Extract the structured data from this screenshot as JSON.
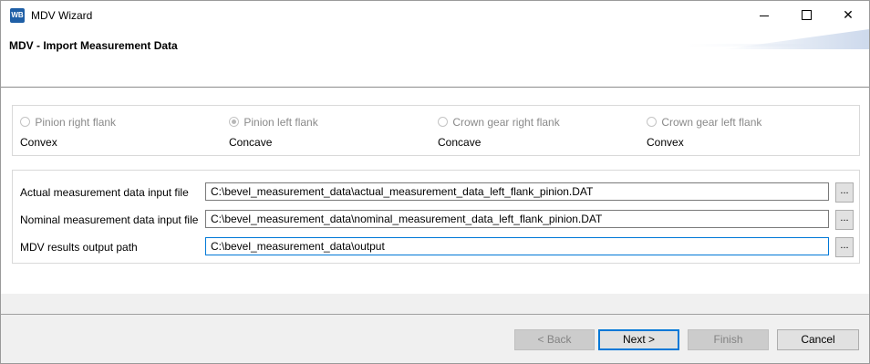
{
  "window": {
    "title": "MDV Wizard",
    "app_icon_text": "WB",
    "controls": {
      "minimize": "minimize",
      "maximize": "maximize",
      "close": "✕"
    }
  },
  "banner": {
    "title": "MDV - Import Measurement Data"
  },
  "flanks": [
    {
      "label": "Pinion right flank",
      "type": "Convex",
      "selected": false
    },
    {
      "label": "Pinion left flank",
      "type": "Concave",
      "selected": true
    },
    {
      "label": "Crown gear right flank",
      "type": "Concave",
      "selected": false
    },
    {
      "label": "Crown gear left flank",
      "type": "Convex",
      "selected": false
    }
  ],
  "files": [
    {
      "label": "Actual measurement data input file",
      "value": "C:\\bevel_measurement_data\\actual_measurement_data_left_flank_pinion.DAT",
      "browse": "..."
    },
    {
      "label": "Nominal measurement data input file",
      "value": "C:\\bevel_measurement_data\\nominal_measurement_data_left_flank_pinion.DAT",
      "browse": "..."
    },
    {
      "label": "MDV results output path",
      "value": "C:\\bevel_measurement_data\\output",
      "browse": "..."
    }
  ],
  "buttons": {
    "back": "< Back",
    "next": "Next >",
    "finish": "Finish",
    "cancel": "Cancel"
  },
  "colors": {
    "accent": "#0078d7",
    "disabled_text": "#838383"
  }
}
